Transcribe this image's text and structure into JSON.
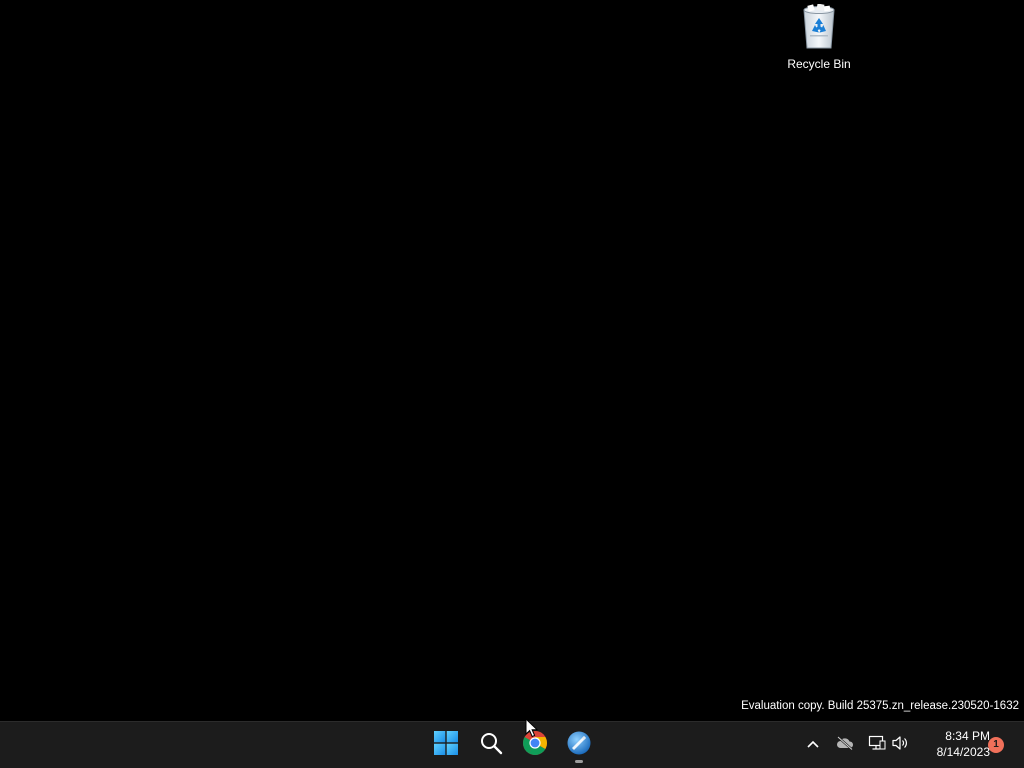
{
  "desktop": {
    "background_color": "#000000",
    "icons": [
      {
        "label": "Recycle Bin",
        "icon": "recycle-bin-icon"
      }
    ],
    "watermark": "Evaluation copy. Build 25375.zn_release.230520-1632"
  },
  "taskbar": {
    "background_color": "#1c1c1c",
    "pinned": [
      {
        "name": "Start",
        "icon": "windows-start-icon"
      },
      {
        "name": "Search",
        "icon": "search-icon"
      },
      {
        "name": "Google Chrome",
        "icon": "chrome-icon"
      },
      {
        "name": "App",
        "icon": "app-icon",
        "running": true
      }
    ],
    "tray": {
      "icons": [
        "chevron-up-icon",
        "cloud-offline-icon",
        "network-icon",
        "volume-icon"
      ],
      "time": "8:34 PM",
      "date": "8/14/2023",
      "notification_count": "1",
      "notification_color": "#f0705a"
    }
  }
}
